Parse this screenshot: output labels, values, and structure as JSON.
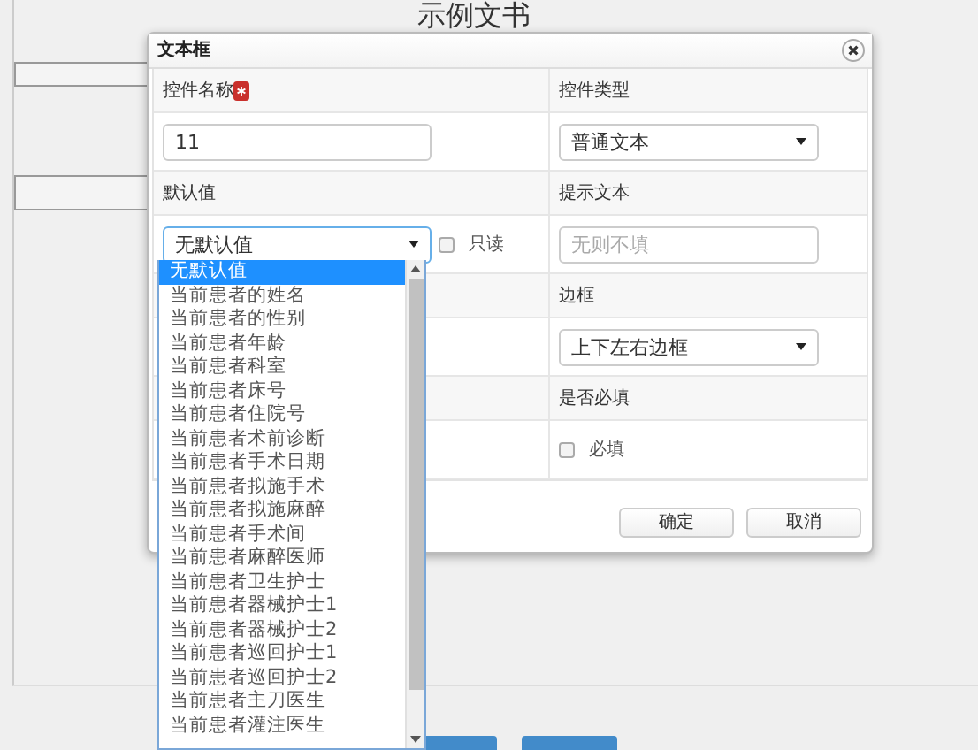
{
  "page": {
    "title": "示例文书"
  },
  "dialog": {
    "title": "文本框",
    "rows": [
      {
        "left": {
          "label": "控件名称",
          "required": true,
          "kind": "text",
          "value": "11"
        },
        "right": {
          "label": "控件类型",
          "kind": "select",
          "value": "普通文本"
        }
      },
      {
        "left": {
          "label": "默认值",
          "kind": "select",
          "value": "无默认值",
          "focused": true,
          "checkbox": {
            "label": "只读",
            "checked": false
          }
        },
        "right": {
          "label": "提示文本",
          "kind": "text",
          "placeholder": "无则不填"
        }
      },
      {
        "right": {
          "label": "边框",
          "kind": "select",
          "value": "上下左右边框"
        }
      },
      {
        "right": {
          "label": "是否必填",
          "kind": "checkbox",
          "checkbox": {
            "label": "必填",
            "checked": false
          }
        }
      }
    ],
    "buttons": [
      "确定",
      "取消"
    ]
  },
  "dropdown": {
    "options": [
      {
        "label": "无默认值",
        "selected": true
      },
      {
        "label": "当前患者的姓名",
        "selected": false
      },
      {
        "label": "当前患者的性别",
        "selected": false
      },
      {
        "label": "当前患者年龄",
        "selected": false
      },
      {
        "label": "当前患者科室",
        "selected": false
      },
      {
        "label": "当前患者床号",
        "selected": false
      },
      {
        "label": "当前患者住院号",
        "selected": false
      },
      {
        "label": "当前患者术前诊断",
        "selected": false
      },
      {
        "label": "当前患者手术日期",
        "selected": false
      },
      {
        "label": "当前患者拟施手术",
        "selected": false
      },
      {
        "label": "当前患者拟施麻醉",
        "selected": false
      },
      {
        "label": "当前患者手术间",
        "selected": false
      },
      {
        "label": "当前患者麻醉医师",
        "selected": false
      },
      {
        "label": "当前患者卫生护士",
        "selected": false
      },
      {
        "label": "当前患者器械护士1",
        "selected": false
      },
      {
        "label": "当前患者器械护士2",
        "selected": false
      },
      {
        "label": "当前患者巡回护士1",
        "selected": false
      },
      {
        "label": "当前患者巡回护士2",
        "selected": false
      },
      {
        "label": "当前患者主刀医生",
        "selected": false
      },
      {
        "label": "当前患者灌注医生",
        "selected": false
      }
    ]
  }
}
